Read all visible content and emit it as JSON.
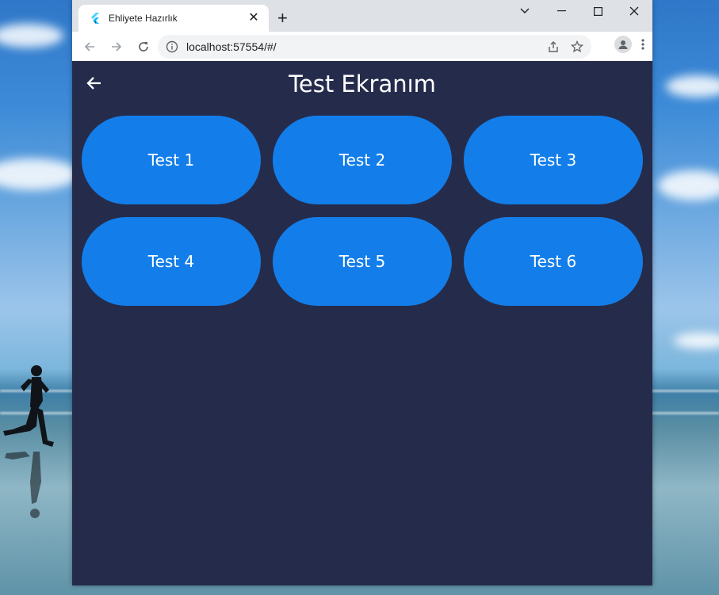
{
  "browser": {
    "tab_title": "Ehliyete Hazırlık",
    "url": "localhost:57554/#/"
  },
  "app": {
    "title": "Test Ekranım",
    "tests": [
      {
        "label": "Test 1"
      },
      {
        "label": "Test 2"
      },
      {
        "label": "Test 3"
      },
      {
        "label": "Test 4"
      },
      {
        "label": "Test 5"
      },
      {
        "label": "Test 6"
      }
    ]
  },
  "colors": {
    "page_bg": "#252c4b",
    "button": "#137eea",
    "text": "#ffffff"
  }
}
